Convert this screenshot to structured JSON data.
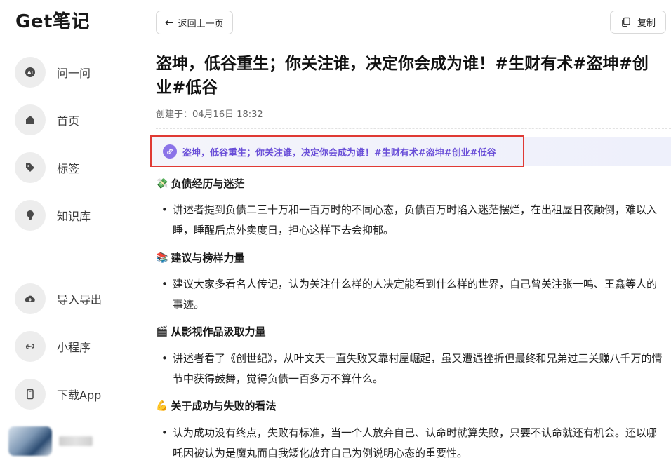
{
  "app": {
    "logo": "Get笔记"
  },
  "sidebar": {
    "items": [
      {
        "label": "问一问",
        "icon": "ai-icon"
      },
      {
        "label": "首页",
        "icon": "home-icon"
      },
      {
        "label": "标签",
        "icon": "tag-icon"
      },
      {
        "label": "知识库",
        "icon": "bulb-icon"
      },
      {
        "label": "导入导出",
        "icon": "cloud-icon"
      },
      {
        "label": "小程序",
        "icon": "link-icon"
      },
      {
        "label": "下载App",
        "icon": "phone-icon"
      }
    ]
  },
  "toolbar": {
    "back_label": "返回上一页",
    "copy_label": "复制"
  },
  "note": {
    "title": "盗坤，低谷重生；你关注谁，决定你会成为谁！#生财有术#盗坤#创业#低谷",
    "created": "创建于：04月16日 18:32",
    "link_text": "盗坤，低谷重生；你关注谁，决定你会成为谁！#生财有术#盗坤#创业#低谷",
    "sections": [
      {
        "emoji": "💸",
        "heading": "负债经历与迷茫",
        "bullet": "讲述者提到负债二三十万和一百万时的不同心态，负债百万时陷入迷茫摆烂，在出租屋日夜颠倒，难以入睡，睡醒后点外卖度日，担心这样下去会抑郁。"
      },
      {
        "emoji": "📚",
        "heading": "建议与榜样力量",
        "bullet": "建议大家多看名人传记，认为关注什么样的人决定能看到什么样的世界，自己曾关注张一鸣、王鑫等人的事迹。"
      },
      {
        "emoji": "🎬",
        "heading": "从影视作品汲取力量",
        "bullet": "讲述者看了《创世纪》，从叶文天一直失败又靠村屋崛起，虽又遭遇挫折但最终和兄弟过三关赚八千万的情节中获得鼓舞，觉得负债一百多万不算什么。"
      },
      {
        "emoji": "💪",
        "heading": "关于成功与失败的看法",
        "bullet": "认为成功没有终点，失败有标准，当一个人放弃自己、认命时就算失败，只要不认命就还有机会。还以哪吒因被认为是魔丸而自我矮化放弃自己为例说明心态的重要性。"
      }
    ]
  },
  "colors": {
    "accent": "#6a4fd8",
    "highlight_border": "#e03a34"
  }
}
